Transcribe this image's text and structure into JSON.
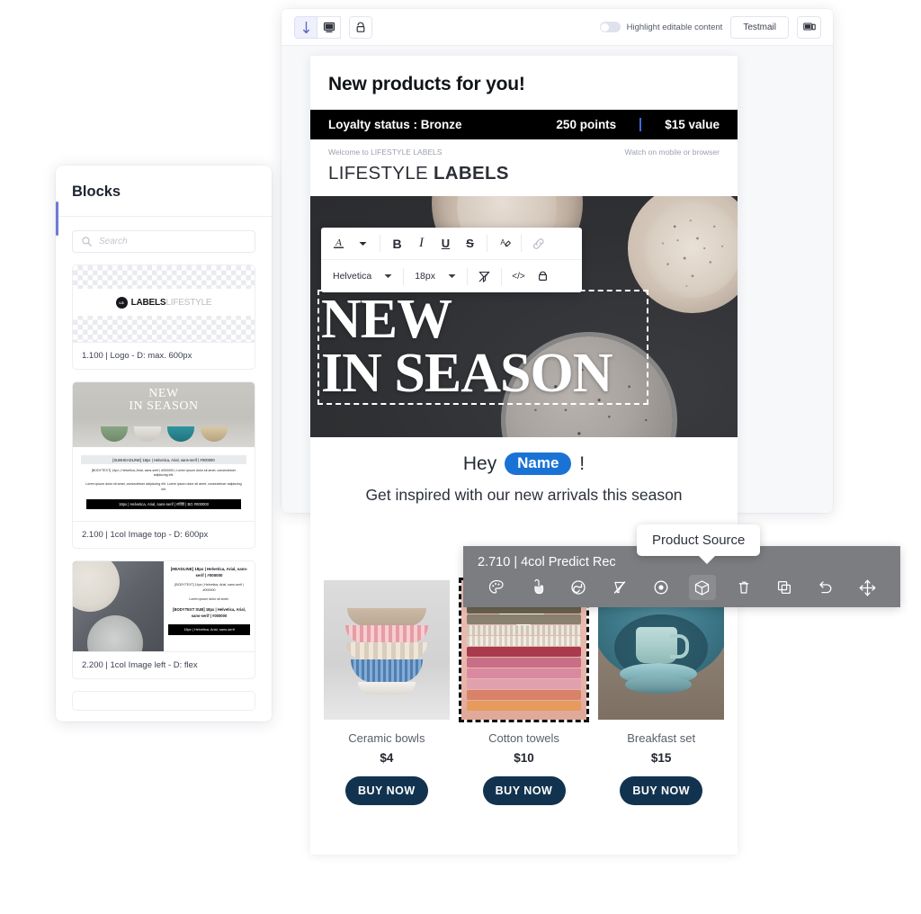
{
  "toolbar": {
    "mode_buttons": [
      {
        "name": "bolt-icon",
        "label": "Quick actions"
      },
      {
        "name": "desktop-icon",
        "label": "Desktop preview"
      },
      {
        "name": "mobile-icon",
        "label": "Mobile preview"
      }
    ],
    "highlight_toggle_label": "Highlight editable content",
    "testmail_label": "Testmail",
    "screen_icon": "device-icon"
  },
  "email": {
    "subject": "New products for you!",
    "loyalty": {
      "status": "Loyalty status : Bronze",
      "points": "250 points",
      "value": "$15 value",
      "divider_color": "#3d6bd8",
      "bg": "#000000"
    },
    "preheader_left": "Welcome to LIFESTYLE LABELS",
    "preheader_right": "Watch on mobile or browser",
    "brand_light": "LIFESTYLE",
    "brand_bold": "LABELS",
    "hero_line1": "NEW",
    "hero_line2": "IN SEASON",
    "greeting_prefix": "Hey",
    "greeting_chip": "Name",
    "greeting_suffix": "!",
    "greeting_chip_color": "#1a73d4",
    "subgreeting": "Get inspired with our new arrivals this season",
    "products": [
      {
        "name": "Ceramic bowls",
        "price": "$4",
        "cta": "BUY NOW",
        "selected": false
      },
      {
        "name": "Cotton towels",
        "price": "$10",
        "cta": "BUY NOW",
        "selected": true
      },
      {
        "name": "Breakfast set",
        "price": "$15",
        "cta": "BUY NOW",
        "selected": false
      }
    ]
  },
  "rich_text_toolbar": {
    "row1": [
      {
        "name": "text-color-icon",
        "glyph": "A"
      },
      {
        "name": "text-color-caret-icon",
        "glyph": "▾"
      },
      {
        "name": "bold-icon",
        "glyph": "B"
      },
      {
        "name": "italic-icon",
        "glyph": "I"
      },
      {
        "name": "underline-icon",
        "glyph": "U"
      },
      {
        "name": "strikethrough-icon",
        "glyph": "S"
      },
      {
        "name": "highlight-icon",
        "glyph": "A"
      },
      {
        "name": "link-icon",
        "glyph": "🔗"
      }
    ],
    "font_family": "Helvetica",
    "font_size": "18px",
    "row2_icons": [
      {
        "name": "clear-formatting-icon"
      },
      {
        "name": "code-icon",
        "glyph": "</>"
      },
      {
        "name": "lock-icon"
      }
    ]
  },
  "context_toolbar": {
    "block_label": "2.710 | 4col Predict Rec",
    "tooltip": "Product Source",
    "bg": "#7b7d80",
    "icons": [
      {
        "name": "palette-icon",
        "active": false
      },
      {
        "name": "click-cursor-icon",
        "active": false
      },
      {
        "name": "refresh-icon",
        "active": false
      },
      {
        "name": "image-off-icon",
        "active": false
      },
      {
        "name": "target-icon",
        "active": false
      },
      {
        "name": "product-source-box-icon",
        "active": true
      },
      {
        "name": "trash-icon",
        "active": false
      },
      {
        "name": "duplicate-icon",
        "active": false
      },
      {
        "name": "undo-icon",
        "active": false
      },
      {
        "name": "move-icon",
        "active": false
      }
    ]
  },
  "blocks_panel": {
    "title": "Blocks",
    "search_placeholder": "Search",
    "accent_color": "#6b7bd6",
    "items": [
      {
        "caption": "1.100 | Logo - D: max. 600px",
        "thumb_type": "logo",
        "logo_light": "LIFESTYLE",
        "logo_bold": "LABELS"
      },
      {
        "caption": "2.100 | 1col Image top - D: 600px",
        "thumb_type": "image-top",
        "hero1": "NEW",
        "hero2": "IN SEASON",
        "subheadline": "[SUBHEADLINE] 18px | Helvetica, Arial, sans-serif | #000000",
        "bodytext": "[BODYTEXT] 14px | Helvetica, Arial, sans-serif | #000000 | Lorem ipsum dolor sit amet, consectetuer adipiscing elit.",
        "lorem": "Lorem ipsum dolor sit amet, consectetuer adipiscing elit. Lorem ipsum dolor sit amet, consectetuer adipiscing elit.",
        "blackbar": "18px | Helvetica, Arial, sans-serif | #ffffff | BG #000000"
      },
      {
        "caption": "2.200 | 1col Image left - D: flex",
        "thumb_type": "image-left",
        "headline": "[HEADLINE] 18px | Helvetica, Arial, sans-serif | #000000",
        "bodytext": "[BODYTEXT] 14px | Helvetica, Arial, sans-serif | #000000",
        "lorem": "Lorem ipsum dolor sit amet.",
        "bodysub": "[BODYTEXT SUB] 18px | Helvetica, Arial, sans-serif | #000000",
        "blackbar": "18px | Helvetica, Arial, sans-serif"
      }
    ]
  }
}
